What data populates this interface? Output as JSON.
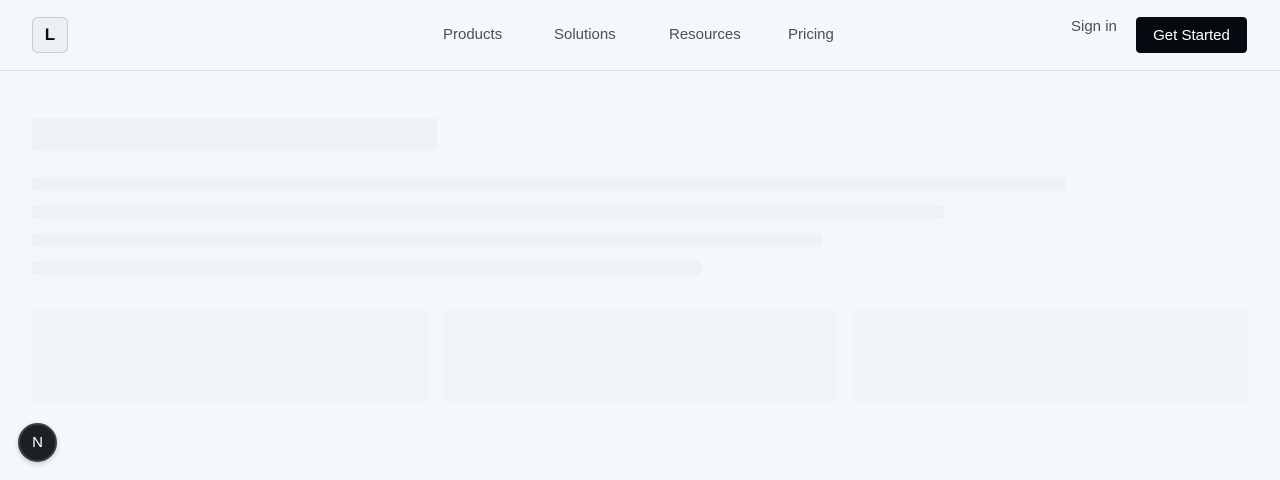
{
  "header": {
    "logo_letter": "L",
    "nav": [
      {
        "label": "Products"
      },
      {
        "label": "Solutions"
      },
      {
        "label": "Resources"
      },
      {
        "label": "Pricing"
      }
    ],
    "signin_label": "Sign in",
    "cta_label": "Get Started"
  },
  "badge": {
    "letter": "N"
  },
  "colors": {
    "background": "#f5f8fb",
    "cta_background": "#070a10",
    "skeleton": "#eef2f6",
    "badge": "#1c1f24"
  },
  "icons": {
    "logo": "logo-letter-icon",
    "badge": "n-badge-icon"
  }
}
